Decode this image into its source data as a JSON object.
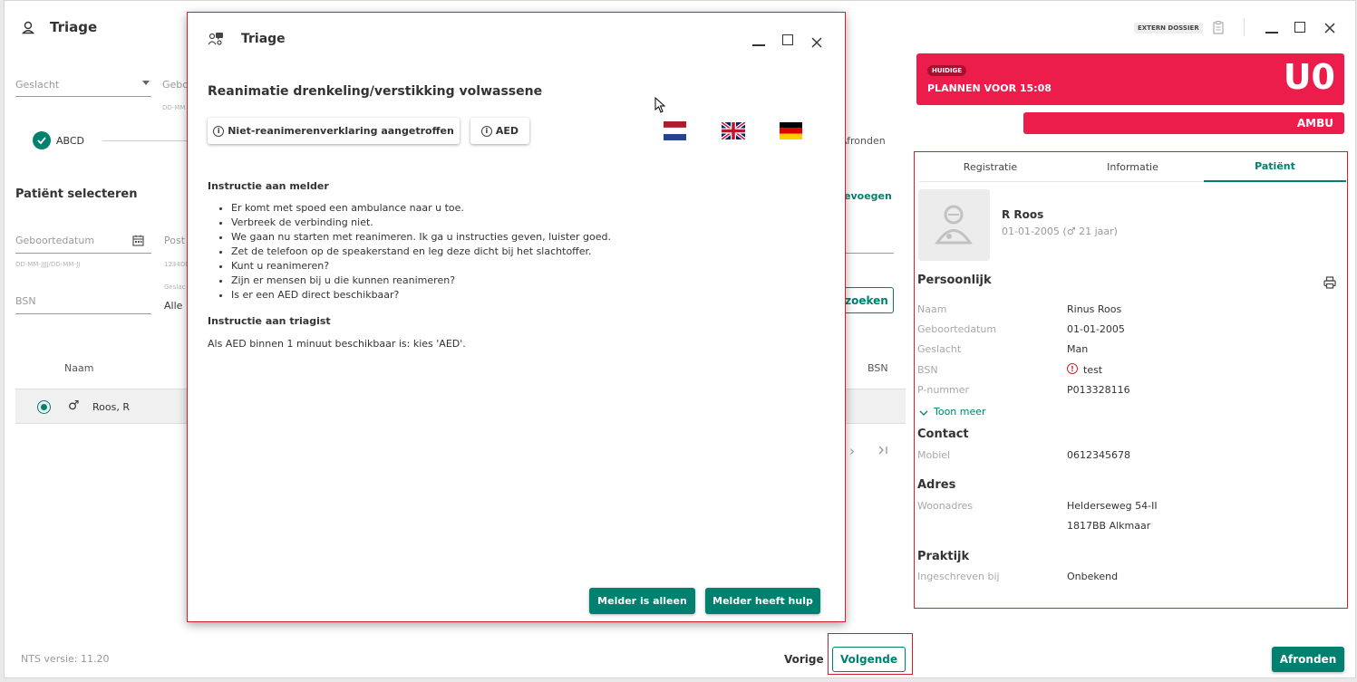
{
  "main": {
    "title": "Triage",
    "fields": {
      "geslacht_placeholder": "Geslacht",
      "geboorte_partial": "Gebo",
      "geboorte_hint_partial": "DD-MM",
      "abcd_label": "ABCD",
      "afronden_step": "Afronden"
    },
    "patient_select": {
      "heading": "Patiënt selecteren",
      "toevoegen_partial": "evoegen",
      "geboortedatum_placeholder": "Geboortedatum",
      "geboortedatum_hint": "DD-MM-JJJJ/DD-MM-JJ",
      "postcode_partial": "Post",
      "postcode_hint_partial": "1234DD",
      "bsn_placeholder": "BSN",
      "geslacht_small_partial": "Geslac",
      "geslacht_value": "Alle",
      "zoeken_partial": "zoeken",
      "col_naam": "Naam",
      "col_bsn": "BSN",
      "rows": [
        {
          "name": "Roos, R",
          "gender_icon": "♂"
        }
      ]
    },
    "footer": {
      "version": "NTS versie: 11.20",
      "vorige": "Vorige",
      "volgende": "Volgende",
      "afronden": "Afronden"
    }
  },
  "header_right": {
    "extern_dossier": "EXTERN DOSSIER"
  },
  "urgency": {
    "badge": "HUIDIGE",
    "plan_text": "PLANNEN VOOR 15:08",
    "code": "U0",
    "ambu": "AMBU",
    "color": "#ec1c4b"
  },
  "tabs": [
    "Registratie",
    "Informatie",
    "Patiënt"
  ],
  "patient": {
    "name": "R Roos",
    "dob_line": "01-01-2005 (♂ 21 jaar)",
    "persoonlijk": "Persoonlijk",
    "rows": [
      {
        "label": "Naam",
        "value": "Rinus Roos"
      },
      {
        "label": "Geboortedatum",
        "value": "01-01-2005"
      },
      {
        "label": "Geslacht",
        "value": "Man"
      },
      {
        "label": "BSN",
        "value": "test"
      },
      {
        "label": "P-nummer",
        "value": "P013328116"
      }
    ],
    "toon_meer": "Toon meer",
    "contact": "Contact",
    "mobiel_label": "Mobiel",
    "mobiel_value": "0612345678",
    "adres": "Adres",
    "woonadres_label": "Woonadres",
    "woonadres_line1": "Helderseweg 54-II",
    "woonadres_line2": "1817BB Alkmaar",
    "praktijk": "Praktijk",
    "ingeschreven_label": "Ingeschreven bij",
    "ingeschreven_value": "Onbekend"
  },
  "dialog": {
    "title": "Triage",
    "heading": "Reanimatie drenkeling/verstikking volwassene",
    "chip_nrv": "Niet-reanimerenverklaring aangetroffen",
    "chip_aed": "AED",
    "melder_heading": "Instructie aan melder",
    "melder_items": [
      "Er komt met spoed een ambulance naar u toe.",
      "Verbreek de verbinding niet.",
      "We gaan nu starten met reanimeren. Ik ga u instructies geven, luister goed.",
      "Zet de telefoon op de speakerstand en leg deze dicht bij het slachtoffer.",
      "Kunt u reanimeren?",
      "Zijn er mensen bij u die kunnen reanimeren?",
      "Is er een AED direct beschikbaar?"
    ],
    "triagist_heading": "Instructie aan triagist",
    "triagist_text": "Als AED binnen 1 minuut beschikbaar is: kies 'AED'.",
    "btn_alleen": "Melder is alleen",
    "btn_hulp": "Melder heeft hulp"
  }
}
